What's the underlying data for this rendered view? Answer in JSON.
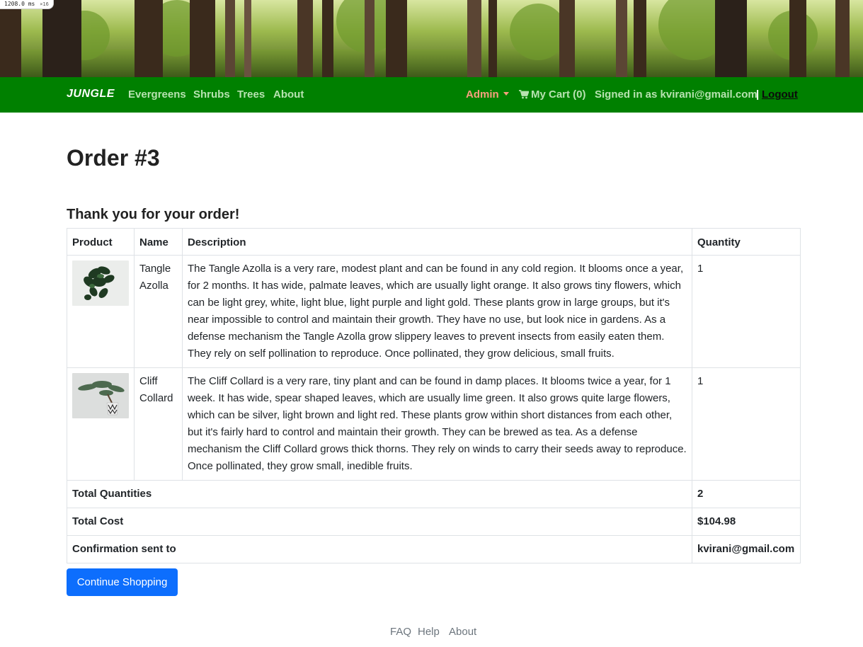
{
  "perf_badge": {
    "value": "1208.0",
    "unit": "ms",
    "sub": "×16"
  },
  "navbar": {
    "brand": "JUNGLE",
    "links": [
      "Evergreens",
      "Shrubs",
      "Trees",
      "About"
    ],
    "admin_label": "Admin",
    "cart_label": "My Cart (0)",
    "signed_in_text": "Signed in as kvirani@gmail.com",
    "separator": "|",
    "logout_label": "Logout",
    "colors": {
      "bar": "#008000",
      "link": "#b7e2b0",
      "admin": "#f7a07e"
    }
  },
  "page": {
    "title": "Order #3",
    "thank_you": "Thank you for your order!"
  },
  "table": {
    "headers": [
      "Product",
      "Name",
      "Description",
      "Quantity"
    ],
    "rows": [
      {
        "image_icon": "plant-hanging-pothos",
        "name": "Tangle Azolla",
        "description": "The Tangle Azolla is a very rare, modest plant and can be found in any cold region. It blooms once a year, for 2 months. It has wide, palmate leaves, which are usually light orange. It also grows tiny flowers, which can be light grey, white, light blue, light purple and light gold. These plants grow in large groups, but it's near impossible to control and maintain their growth. They have no use, but look nice in gardens. As a defense mechanism the Tangle Azolla grow slippery leaves to prevent insects from easily eaten them. They rely on self pollination to reproduce. Once pollinated, they grow delicious, small fruits.",
        "quantity": "1"
      },
      {
        "image_icon": "plant-bonsai-pot",
        "name": "Cliff Collard",
        "description": "The Cliff Collard is a very rare, tiny plant and can be found in damp places. It blooms twice a year, for 1 week. It has wide, spear shaped leaves, which are usually lime green. It also grows quite large flowers, which can be silver, light brown and light red. These plants grow within short distances from each other, but it's fairly hard to control and maintain their growth. They can be brewed as tea. As a defense mechanism the Cliff Collard grows thick thorns. They rely on winds to carry their seeds away to reproduce. Once pollinated, they grow small, inedible fruits.",
        "quantity": "1"
      }
    ],
    "totals": [
      {
        "label": "Total Quantities",
        "value": "2"
      },
      {
        "label": "Total Cost",
        "value": "$104.98"
      },
      {
        "label": "Confirmation sent to",
        "value": "kvirani@gmail.com"
      }
    ]
  },
  "continue_button": "Continue Shopping",
  "footer": {
    "links": [
      "FAQ",
      "Help",
      "About"
    ]
  }
}
